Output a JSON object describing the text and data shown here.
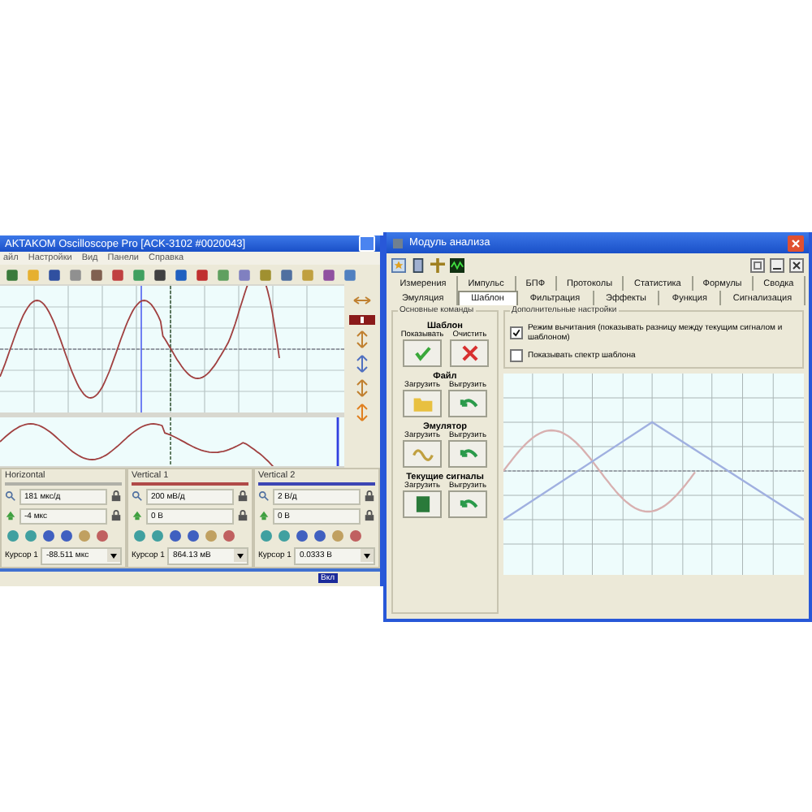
{
  "scope_window": {
    "title": "AKTAKOM Oscilloscope Pro [ACK-3102 #0020043]",
    "menu": [
      "айл",
      "Настройки",
      "Вид",
      "Панели",
      "Справка"
    ],
    "panels": [
      {
        "title": "Horizontal",
        "color": "#b0b0a8",
        "scale": "181 мкс/д",
        "offset": "-4 мкс",
        "cursor_label": "Курсор 1",
        "cursor_value": "-88.511 мкс"
      },
      {
        "title": "Vertical 1",
        "color": "#b04a48",
        "scale": "200 мВ/д",
        "offset": "0 В",
        "cursor_label": "Курсор 1",
        "cursor_value": "864.13 мВ"
      },
      {
        "title": "Vertical 2",
        "color": "#3c46b4",
        "scale": "2 В/д",
        "offset": "0 В",
        "cursor_label": "Курсор 1",
        "cursor_value": "0.0333 В"
      }
    ],
    "status_bar": {
      "indicator": "Вкл"
    }
  },
  "analysis_window": {
    "title": "Модуль анализа",
    "tabs_row_1": [
      {
        "label": "Измерения",
        "selected": false
      },
      {
        "label": "Импульс",
        "selected": false
      },
      {
        "label": "БПФ",
        "selected": false
      },
      {
        "label": "Протоколы",
        "selected": false
      },
      {
        "label": "Статистика",
        "selected": false
      },
      {
        "label": "Формулы",
        "selected": false
      },
      {
        "label": "Сводка",
        "selected": false
      }
    ],
    "tabs_row_2": [
      {
        "label": "Эмуляция",
        "selected": false
      },
      {
        "label": "Шаблон",
        "selected": true
      },
      {
        "label": "Фильтрация",
        "selected": false
      },
      {
        "label": "Эффекты",
        "selected": false
      },
      {
        "label": "Функция",
        "selected": false
      },
      {
        "label": "Сигнализация",
        "selected": false
      }
    ],
    "main_commands": {
      "title": "Основные команды",
      "groups": [
        {
          "title": "Шаблон",
          "buttons": [
            {
              "label": "Показывать",
              "kind": "check"
            },
            {
              "label": "Очистить",
              "kind": "cross"
            }
          ]
        },
        {
          "title": "Файл",
          "buttons": [
            {
              "label": "Загрузить",
              "kind": "folder"
            },
            {
              "label": "Выгрузить",
              "kind": "undo"
            }
          ]
        },
        {
          "title": "Эмулятор",
          "buttons": [
            {
              "label": "Загрузить",
              "kind": "wave"
            },
            {
              "label": "Выгрузить",
              "kind": "undo"
            }
          ]
        },
        {
          "title": "Текущие сигналы",
          "buttons": [
            {
              "label": "Загрузить",
              "kind": "chip"
            },
            {
              "label": "Выгрузить",
              "kind": "undo"
            }
          ]
        }
      ]
    },
    "extra_settings": {
      "title": "Дополнительные настройки",
      "options": [
        {
          "label": "Режим вычитания (показывать разницу между текущим сигналом и шаблоном)",
          "checked": true
        },
        {
          "label": "Показывать спектр шаблона",
          "checked": false
        }
      ]
    }
  }
}
